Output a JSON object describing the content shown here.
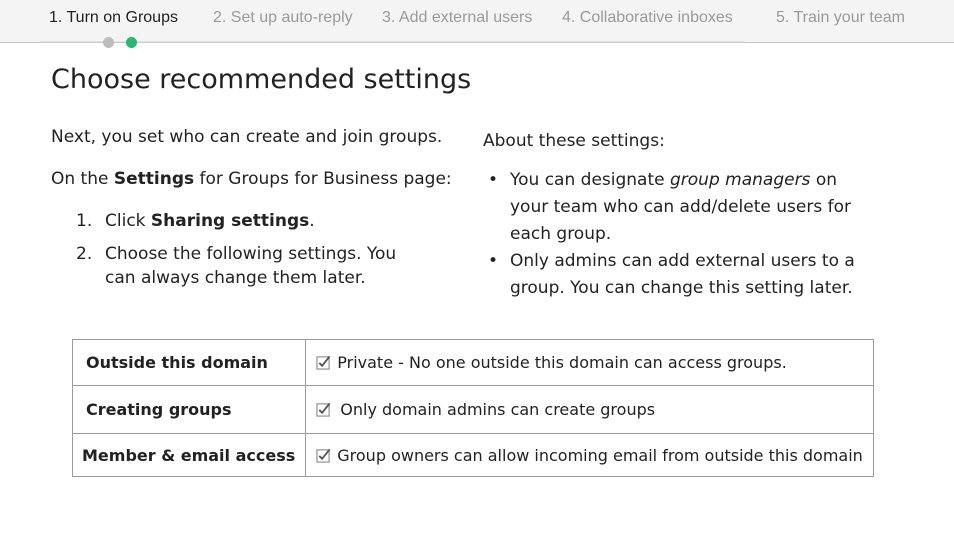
{
  "stepper": {
    "steps": [
      {
        "label": "1. Turn on Groups",
        "active": true
      },
      {
        "label": "2. Set up auto-reply",
        "active": false
      },
      {
        "label": "3. Add external users",
        "active": false
      },
      {
        "label": "4. Collaborative inboxes",
        "active": false
      },
      {
        "label": "5. Train your team",
        "active": false
      }
    ],
    "dot_colors": [
      "#bdbdbd",
      "#2cb673"
    ]
  },
  "main": {
    "title": "Choose recommended settings",
    "intro": "Next, you set who can create and join groups.",
    "settings_line": {
      "prefix": "On the ",
      "bold": "Settings",
      "suffix": " for Groups for Business page:"
    },
    "steps": [
      {
        "num": "1.",
        "prefix": "Click ",
        "bold": "Sharing settings",
        "suffix": "."
      },
      {
        "num": "2.",
        "text": "Choose the following settings. You can always change them later."
      }
    ]
  },
  "about": {
    "heading": "About these settings:",
    "bullets": [
      {
        "prefix": "You can designate ",
        "italic": "group managers",
        "suffix": " on your team who can add/delete users for each group."
      },
      {
        "text": "Only admins can add external users to a group. You can change this setting later."
      }
    ]
  },
  "table": {
    "rows": [
      {
        "label": "Outside this domain",
        "value": "Private - No one outside this domain can access groups.",
        "checked": true
      },
      {
        "label": "Creating groups",
        "value": "Only domain admins can create groups",
        "checked": true
      },
      {
        "label": "Member & email access",
        "value": "Group owners can allow incoming email from outside this domain",
        "checked": true
      }
    ]
  },
  "colors": {
    "accent": "#2cb673",
    "inactive_step": "#9a9a9a",
    "border": "#9a9a9a"
  }
}
